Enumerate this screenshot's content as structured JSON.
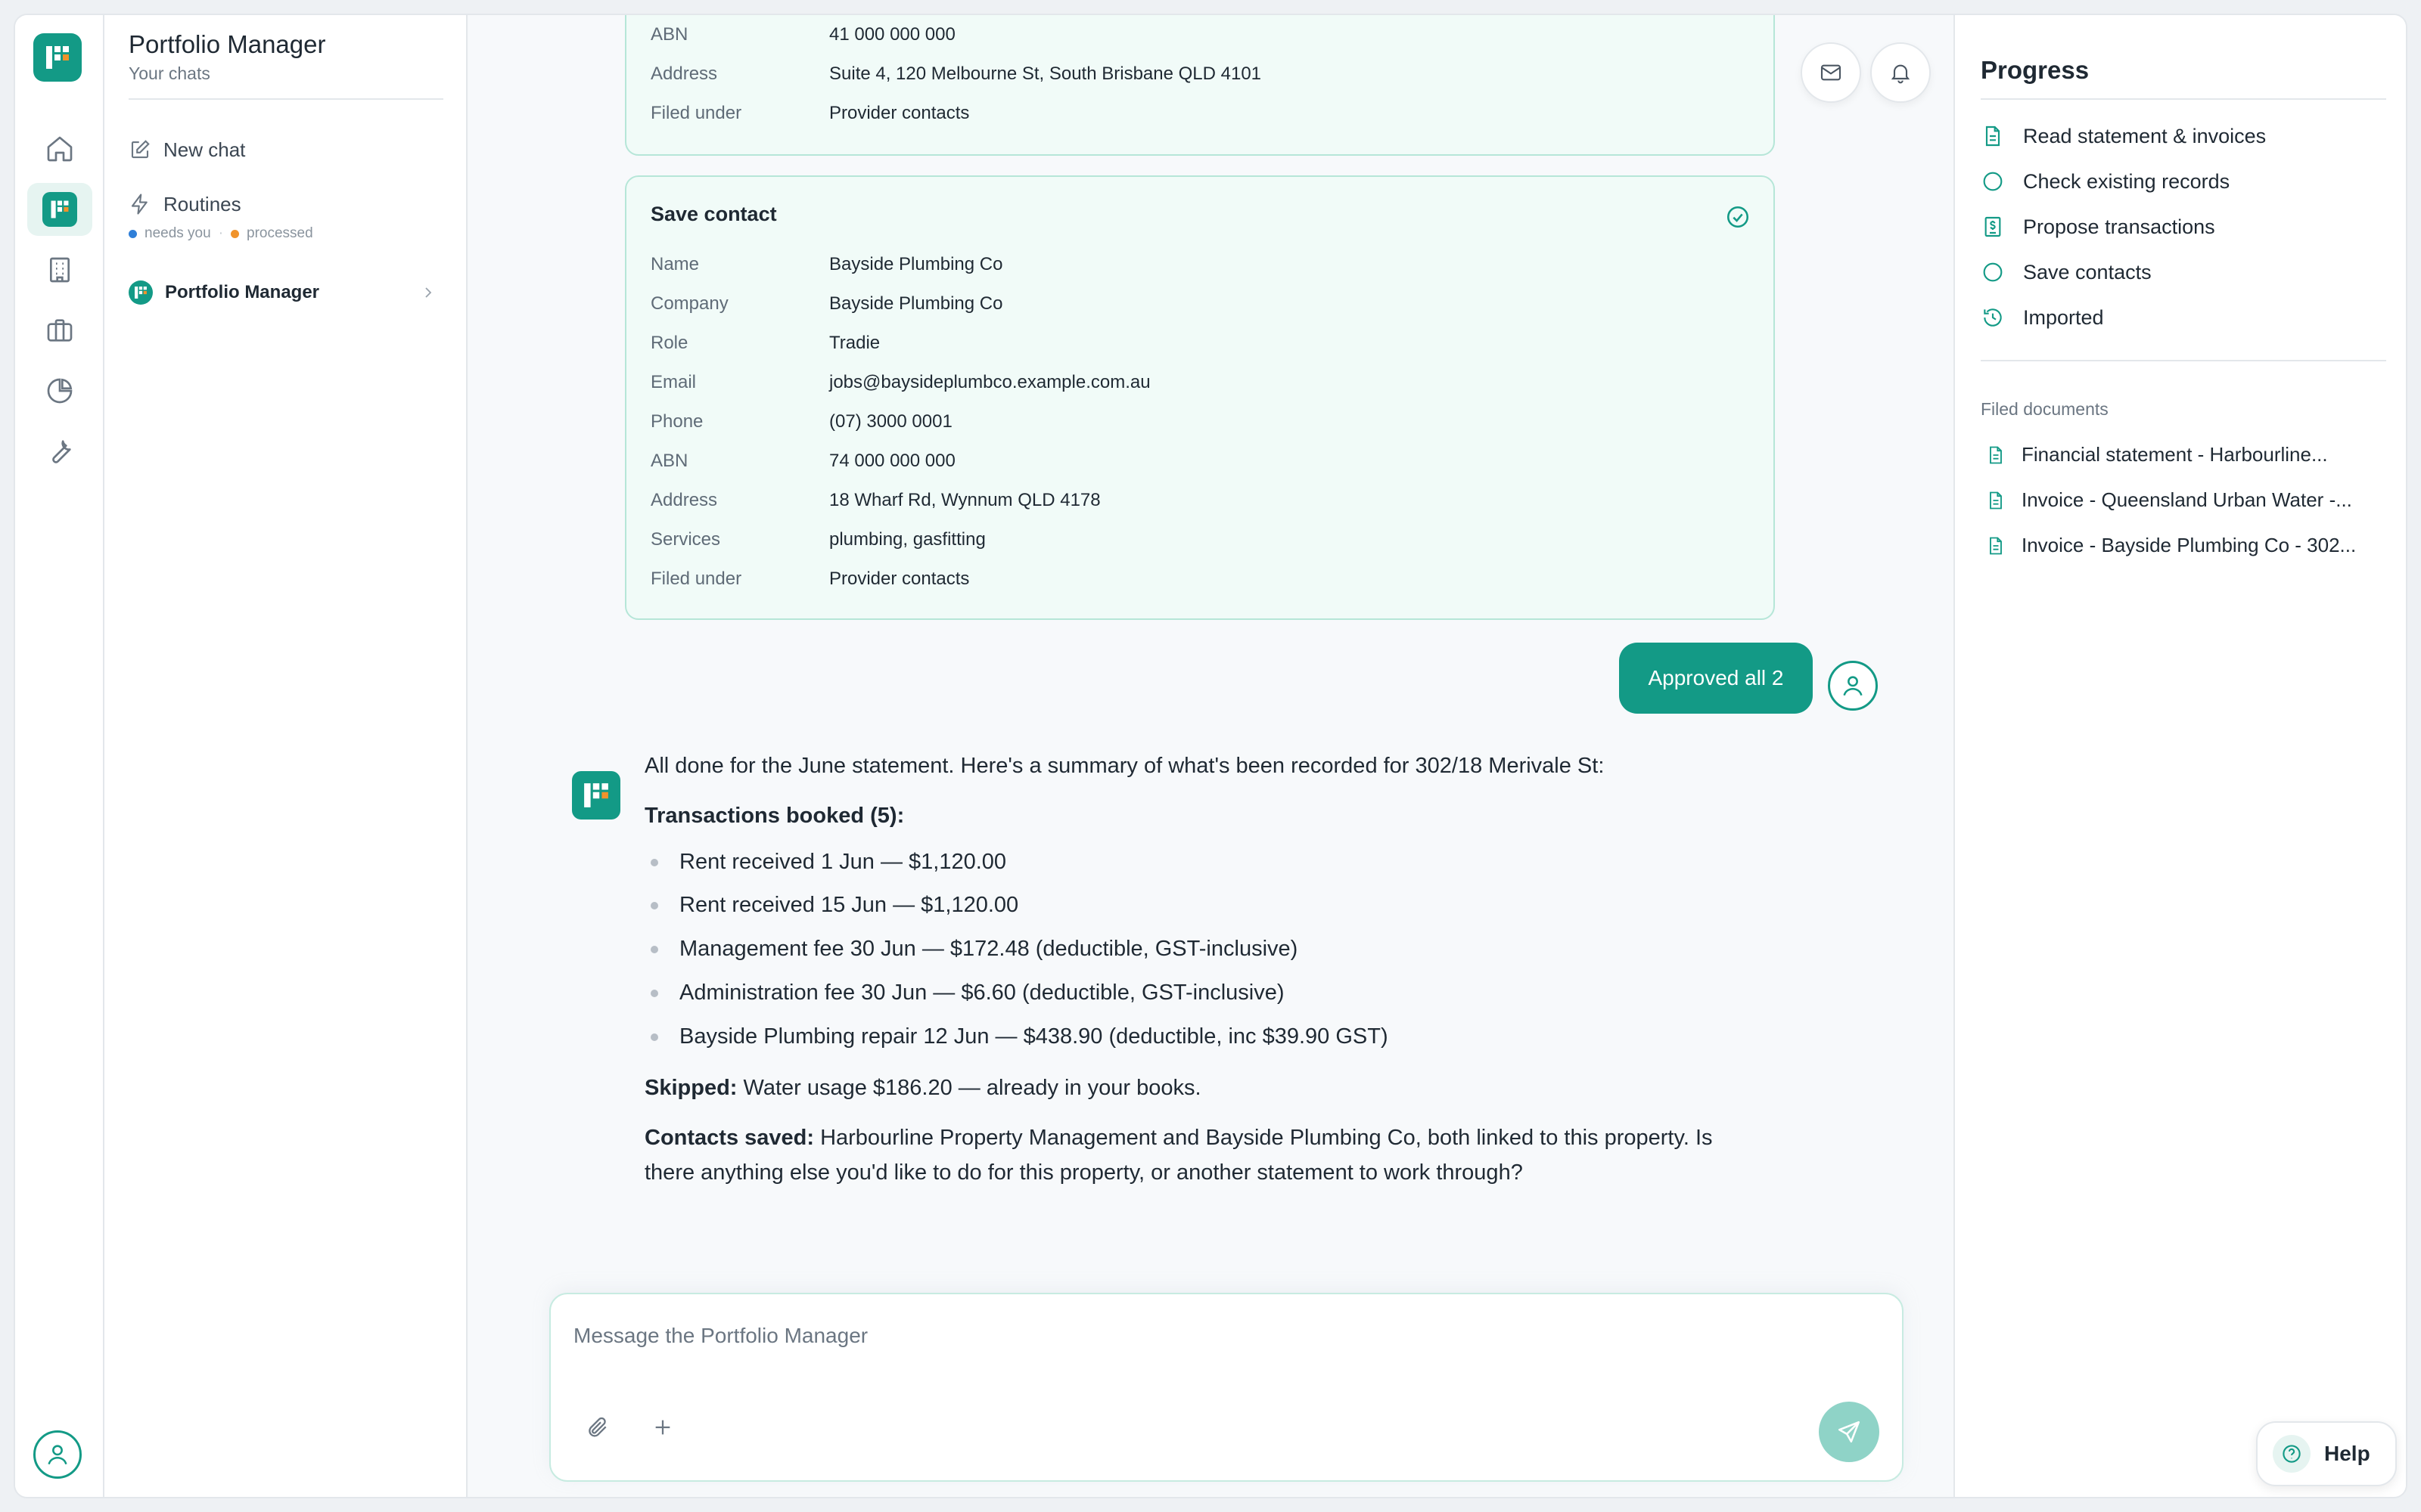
{
  "app": {
    "title": "Portfolio Manager",
    "subtitle": "Your chats"
  },
  "colors": {
    "accent": "#139a86",
    "card_bg": "#f1fbf8",
    "card_border": "#b6e6d8",
    "needs_you": "#2f7fd8",
    "processed": "#f0932b"
  },
  "rail": {
    "items": [
      {
        "icon": "home-icon"
      },
      {
        "icon": "portfolio-manager-icon",
        "active": true
      },
      {
        "icon": "building-icon"
      },
      {
        "icon": "briefcase-icon"
      },
      {
        "icon": "pie-chart-icon"
      },
      {
        "icon": "wrench-icon"
      }
    ]
  },
  "sidebar": {
    "new_chat": "New chat",
    "routines": "Routines",
    "legend": {
      "needs_you": "needs you",
      "processed": "processed",
      "separator": "·"
    },
    "chat_item": "Portfolio Manager"
  },
  "top_card": {
    "rows": [
      {
        "key": "ABN",
        "value": "41 000 000 000"
      },
      {
        "key": "Address",
        "value": "Suite 4, 120 Melbourne St, South Brisbane QLD 4101"
      },
      {
        "key": "Filed under",
        "value": "Provider contacts"
      }
    ]
  },
  "save_card": {
    "title": "Save contact",
    "rows": [
      {
        "key": "Name",
        "value": "Bayside Plumbing Co"
      },
      {
        "key": "Company",
        "value": "Bayside Plumbing Co"
      },
      {
        "key": "Role",
        "value": "Tradie"
      },
      {
        "key": "Email",
        "value": "jobs@baysideplumbco.example.com.au"
      },
      {
        "key": "Phone",
        "value": "(07) 3000 0001"
      },
      {
        "key": "ABN",
        "value": "74 000 000 000"
      },
      {
        "key": "Address",
        "value": "18 Wharf Rd, Wynnum QLD 4178"
      },
      {
        "key": "Services",
        "value": "plumbing, gasfitting"
      },
      {
        "key": "Filed under",
        "value": "Provider contacts"
      }
    ]
  },
  "user_message": "Approved all 2",
  "assistant": {
    "intro": "All done for the June statement. Here's a summary of what's been recorded for 302/18 Merivale St:",
    "transactions_heading": "Transactions booked (5):",
    "transactions": [
      "Rent received 1 Jun — $1,120.00",
      "Rent received 15 Jun — $1,120.00",
      "Management fee 30 Jun — $172.48 (deductible, GST-inclusive)",
      "Administration fee 30 Jun — $6.60 (deductible, GST-inclusive)",
      "Bayside Plumbing repair 12 Jun — $438.90 (deductible, inc $39.90 GST)"
    ],
    "skipped_label": "Skipped:",
    "skipped_text": " Water usage $186.20 — already in your books.",
    "contacts_label": "Contacts saved:",
    "contacts_text_1": " Harbourline Property Management and Bayside Plumbing Co, both linked to this property. Is",
    "contacts_text_2": "there anything else you'd like to do for this property, or another statement to work through?"
  },
  "composer": {
    "placeholder": "Message the Portfolio Manager"
  },
  "progress": {
    "title": "Progress",
    "steps": [
      {
        "label": "Read statement & invoices",
        "icon": "document-icon"
      },
      {
        "label": "Check existing records",
        "icon": "circle-icon"
      },
      {
        "label": "Propose transactions",
        "icon": "dollar-document-icon"
      },
      {
        "label": "Save contacts",
        "icon": "circle-icon"
      },
      {
        "label": "Imported",
        "icon": "history-icon"
      }
    ],
    "filed_heading": "Filed documents",
    "documents": [
      "Financial statement - Harbourline...",
      "Invoice - Queensland Urban Water -...",
      "Invoice - Bayside Plumbing Co - 302..."
    ]
  },
  "help": {
    "label": "Help"
  }
}
